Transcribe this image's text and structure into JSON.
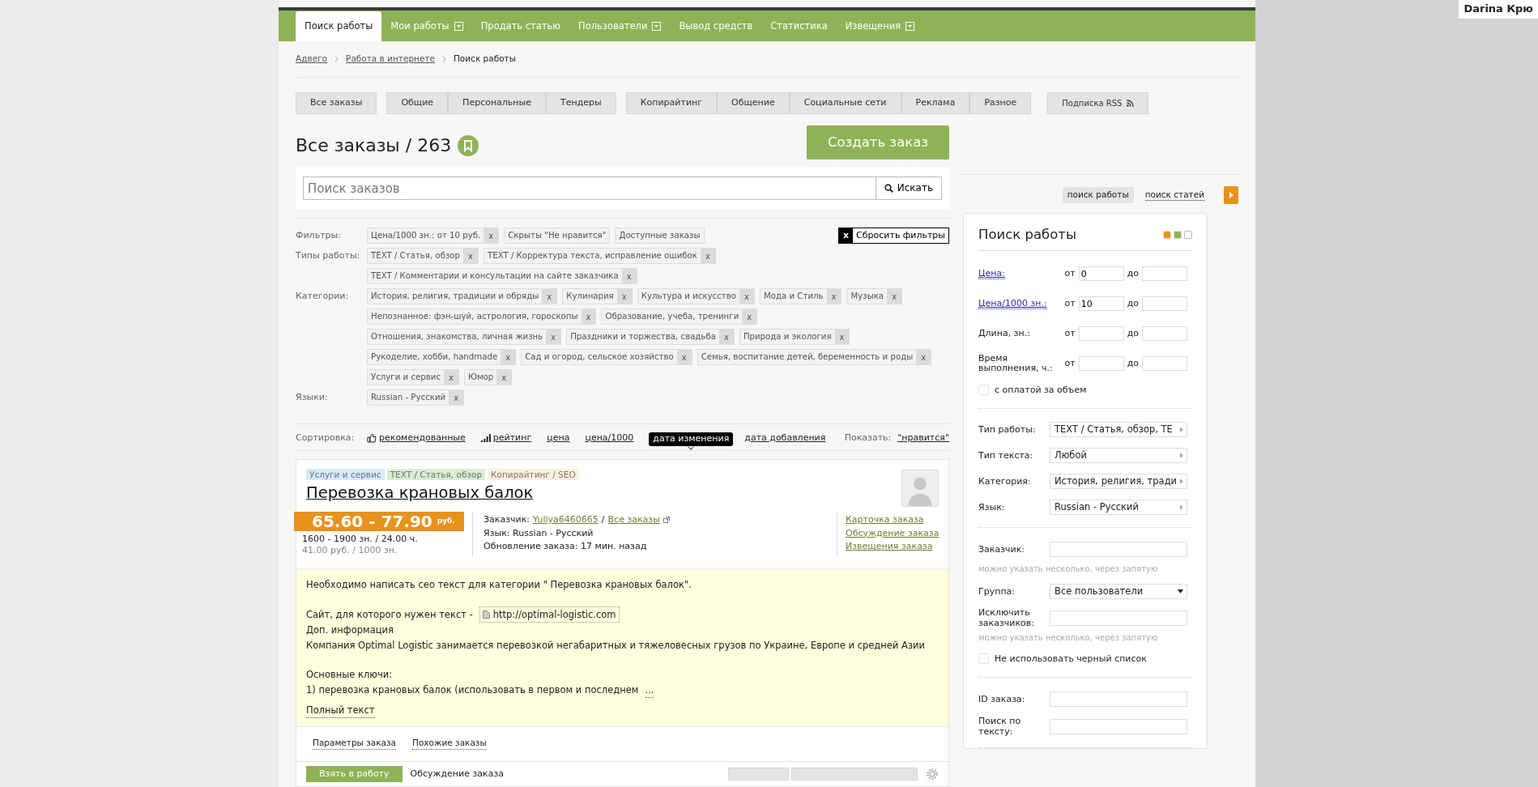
{
  "user_label": "Darina Крю",
  "nav": [
    {
      "label": "Поиск работы",
      "selected": true,
      "dropdown": false
    },
    {
      "label": "Мои работы",
      "selected": false,
      "dropdown": true
    },
    {
      "label": "Продать статью",
      "selected": false,
      "dropdown": false
    },
    {
      "label": "Пользователи",
      "selected": false,
      "dropdown": true
    },
    {
      "label": "Вывод средств",
      "selected": false,
      "dropdown": false
    },
    {
      "label": "Статистика",
      "selected": false,
      "dropdown": false
    },
    {
      "label": "Извещения",
      "selected": false,
      "dropdown": true
    }
  ],
  "breadcrumb": [
    {
      "label": "Адвего",
      "link": true
    },
    {
      "label": "Работа в интернете",
      "link": true
    },
    {
      "label": "Поиск работы",
      "link": false
    }
  ],
  "order_types": [
    [
      "Все заказы"
    ],
    [
      "Общие",
      "Персональные",
      "Тендеры"
    ],
    [
      "Копирайтинг",
      "Общение",
      "Социальные сети",
      "Реклама",
      "Разное"
    ]
  ],
  "rss_button": "Подписка RSS",
  "title": "Все заказы / 263",
  "create_button": "Создать заказ",
  "search": {
    "placeholder": "Поиск заказов",
    "button": "Искать"
  },
  "filters": [
    {
      "label": "Фильтры:",
      "tags": [
        {
          "text": "Цена/1000 зн.: от 10 руб.",
          "remove": "x"
        },
        {
          "text": "Скрыты \"Не нравится\""
        },
        {
          "text": "Доступные заказы"
        }
      ]
    },
    {
      "label": "Типы работы:",
      "tags": [
        {
          "text": "TEXT / Статья, обзор",
          "remove": "x"
        },
        {
          "text": "TEXT / Корректура текста, исправление ошибок",
          "remove": "x"
        },
        {
          "text": "TEXT / Комментарии и консультации на сайте заказчика",
          "remove": "x"
        }
      ]
    },
    {
      "label": "Категории:",
      "tags": [
        {
          "text": "История, религия, традиции и обряды",
          "remove": "x"
        },
        {
          "text": "Кулинария",
          "remove": "x"
        },
        {
          "text": "Культура и искусство",
          "remove": "x"
        },
        {
          "text": "Мода и Стиль",
          "remove": "x"
        },
        {
          "text": "Музыка",
          "remove": "x"
        },
        {
          "text": "Непознанное: фэн-шуй, астрология, гороскопы",
          "remove": "x"
        },
        {
          "text": "Образование, учеба, тренинги",
          "remove": "x"
        },
        {
          "text": "Отношения, знакомства, личная жизнь",
          "remove": "x"
        },
        {
          "text": "Праздники и торжества, свадьба",
          "remove": "x"
        },
        {
          "text": "Природа и экология",
          "remove": "x"
        },
        {
          "text": "Рукоделие, хобби, handmade",
          "remove": "x"
        },
        {
          "text": "Сад и огород, сельское хозяйство",
          "remove": "x"
        },
        {
          "text": "Семья, воспитание детей, беременность и роды",
          "remove": "x"
        },
        {
          "text": "Услуги и сервис",
          "remove": "x"
        },
        {
          "text": "Юмор",
          "remove": "x"
        }
      ]
    },
    {
      "label": "Языки:",
      "tags": [
        {
          "text": "Russian - Русский",
          "remove": "x"
        }
      ]
    }
  ],
  "reset_button": {
    "icon": "x",
    "label": "Сбросить фильтры"
  },
  "sort": {
    "label": "Сортировка:",
    "options": [
      {
        "label": "рекомендованные",
        "selected": false,
        "kind": "recommended"
      },
      {
        "label": "рейтинг",
        "selected": false,
        "kind": "rating"
      },
      {
        "label": "цена",
        "selected": false,
        "kind": "plain"
      },
      {
        "label": "цена/1000",
        "selected": false,
        "kind": "plain"
      },
      {
        "label": "дата изменения",
        "selected": true,
        "kind": "plain"
      },
      {
        "label": "дата добавления",
        "selected": false,
        "kind": "plain"
      }
    ],
    "show_label": "Показать:",
    "show_link": "\"нравится\""
  },
  "order": {
    "tags": [
      {
        "text": "Услуги и сервис",
        "color": "#d8eaf6"
      },
      {
        "text": "TEXT / Статья, обзор",
        "color": "#dbecd2"
      },
      {
        "text": "Копирайтинг / SEO",
        "color": "#fbf0dc"
      }
    ],
    "title": "Перевозка крановых балок",
    "price": "65.60 - 77.90",
    "currency": "руб.",
    "size": "1600 - 1900 зн. / 24.00 ч.",
    "per_1000": "41.00 руб. / 1000 зн.",
    "customer_label": "Заказчик:",
    "customer": "Yuliya6460665",
    "separator": "/",
    "all_orders": "Все заказы",
    "language": "Язык: Russian - Русский",
    "updated": "Обновление заказа: 17 мин. назад",
    "links": [
      "Карточка заказа",
      "Обсуждение заказа",
      "Извещения заказа"
    ],
    "description": [
      {
        "kind": "text",
        "text": "Необходимо написать сео текст для категории \" Перевозка крановых балок\"."
      },
      {
        "kind": "gap"
      },
      {
        "kind": "site",
        "text": "Сайт, для которого нужен текст -",
        "link": "http://optimal-logistic.com"
      },
      {
        "kind": "text",
        "text": "Доп. информация"
      },
      {
        "kind": "text",
        "text": "Компания Optimal Logistic занимается перевозкой негабаритных и тяжеловесных грузов по Украине, Европе и средней Азии"
      },
      {
        "kind": "gap"
      },
      {
        "kind": "text",
        "text": "Основные ключи:"
      },
      {
        "kind": "more",
        "text": "1) перевозка крановых балок (использовать в первом и последнем",
        "link": "..."
      }
    ],
    "full_text": "Полный текст",
    "footer_links": [
      "Параметры заказа",
      "Похожие заказы"
    ],
    "take_button": "Взять в работу",
    "discussion": "Обсуждение заказа"
  },
  "sidebar": {
    "tabs": [
      {
        "label": "поиск работы",
        "selected": true
      },
      {
        "label": "поиск статей",
        "selected": false
      }
    ],
    "title": "Поиск работы",
    "swatches": [
      {
        "color": "#e8911c",
        "selected": false
      },
      {
        "color": "#8db356",
        "selected": false
      },
      {
        "color": "#ffffff",
        "selected": true
      }
    ],
    "sections": [
      [
        {
          "kind": "range",
          "label": "Цена:",
          "link": true,
          "from_label": "от",
          "from_value": "0",
          "to_label": "до"
        },
        {
          "kind": "range",
          "label": "Цена/1000 зн.:",
          "link": true,
          "from_label": "от",
          "from_value": "10",
          "to_label": "до"
        },
        {
          "kind": "range",
          "label": "Длина, зн.:",
          "link": false,
          "from_label": "от",
          "to_label": "до"
        },
        {
          "kind": "range",
          "label": "Время выполнения, ч.:",
          "link": false,
          "from_label": "от",
          "to_label": "до"
        },
        {
          "kind": "checkbox",
          "label": "с оплатой за объем",
          "checked": false
        }
      ],
      [
        {
          "kind": "select",
          "label": "Тип работы:",
          "value": "TEXT / Статья, обзор, TE"
        },
        {
          "kind": "select",
          "label": "Тип текста:",
          "value": "Любой"
        },
        {
          "kind": "select",
          "label": "Категория:",
          "value": "История, религия, тради"
        },
        {
          "kind": "select",
          "label": "Язык:",
          "value": "Russian - Русский"
        }
      ],
      [
        {
          "kind": "input",
          "label": "Заказчик:",
          "hint": "можно указать несколько, через запятую"
        },
        {
          "kind": "dropdown",
          "label": "Группа:",
          "value": "Все пользователи"
        },
        {
          "kind": "input",
          "label": "Исключить заказчиков:",
          "hint": "можно указать несколько, через запятую"
        },
        {
          "kind": "checkbox",
          "label": "Не использовать черный список",
          "checked": false
        }
      ],
      [
        {
          "kind": "input",
          "label": "ID заказа:"
        },
        {
          "kind": "input",
          "label": "Поиск по тексту:"
        }
      ]
    ]
  }
}
